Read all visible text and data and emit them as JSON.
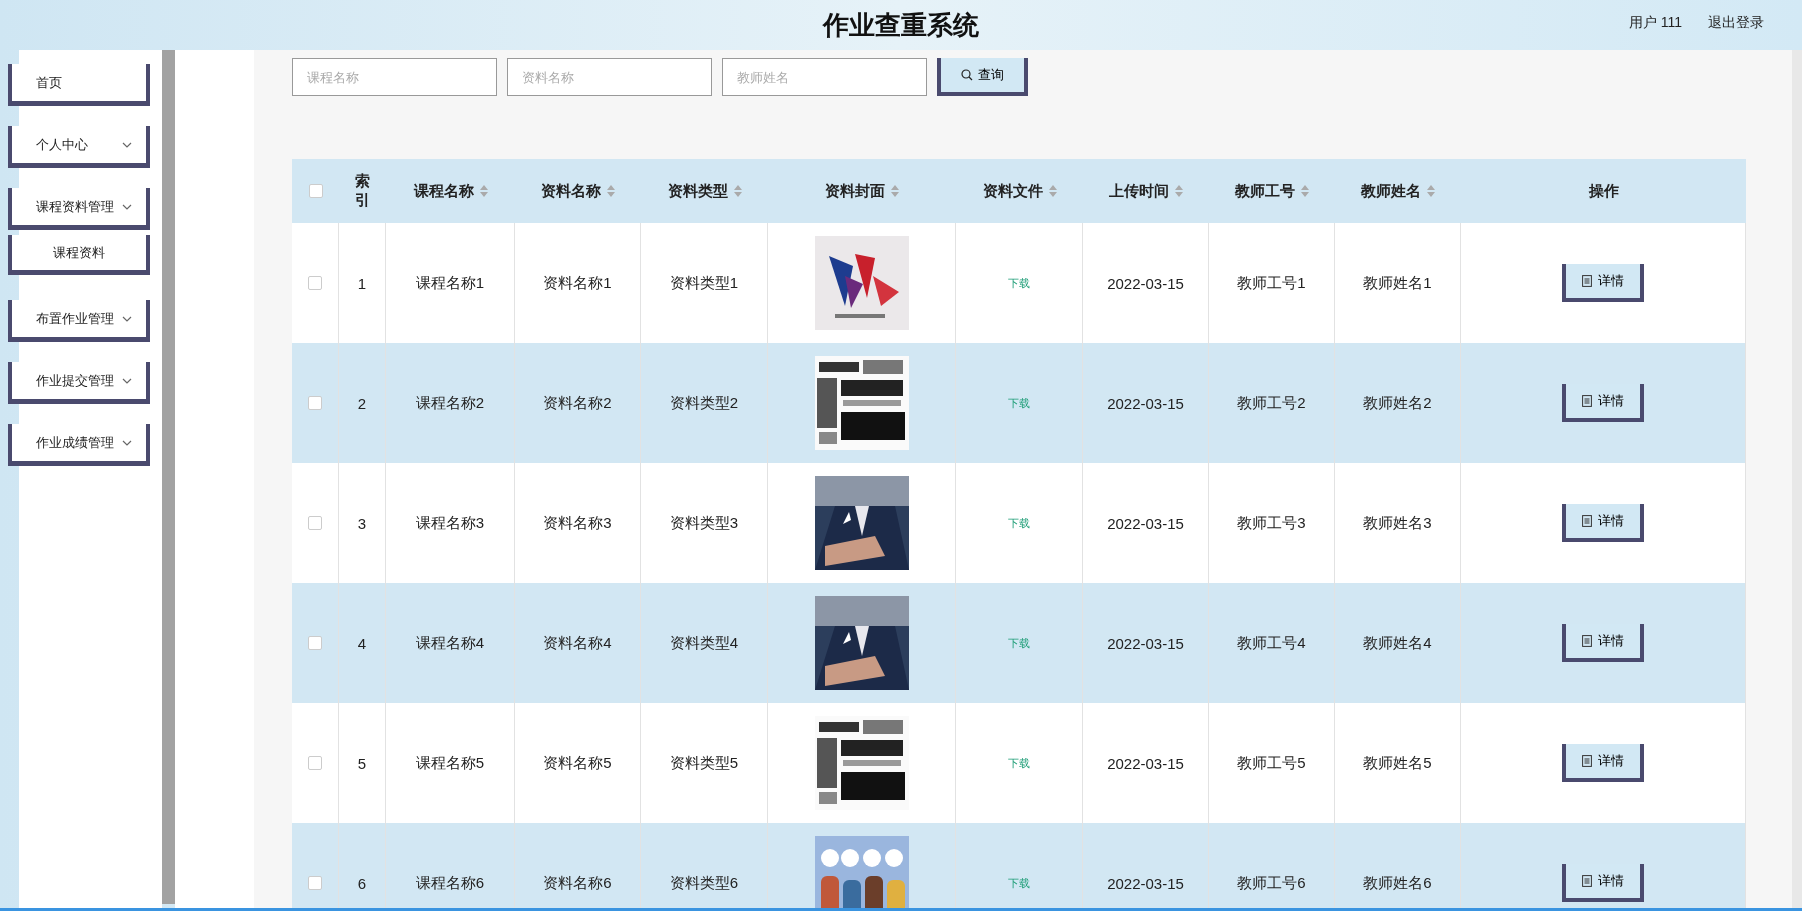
{
  "header": {
    "title": "作业查重系统",
    "user": "用户 111",
    "logout": "退出登录"
  },
  "menu": [
    {
      "kind": "link",
      "label": "首页"
    },
    {
      "kind": "submenu",
      "label": "个人中心"
    },
    {
      "kind": "submenu",
      "label": "课程资料管理",
      "children": [
        {
          "label": "课程资料"
        }
      ]
    },
    {
      "kind": "submenu",
      "label": "布置作业管理"
    },
    {
      "kind": "submenu",
      "label": "作业提交管理"
    },
    {
      "kind": "submenu",
      "label": "作业成绩管理"
    }
  ],
  "search": {
    "fields": [
      {
        "placeholder": "课程名称"
      },
      {
        "placeholder": "资料名称"
      },
      {
        "placeholder": "教师姓名"
      }
    ],
    "button": "查询"
  },
  "table": {
    "select_all": {
      "checked": false
    },
    "columns": [
      {
        "label": "索引",
        "kind": "plain"
      },
      {
        "label": "课程名称",
        "kind": "sortable"
      },
      {
        "label": "资料名称",
        "kind": "sortable"
      },
      {
        "label": "资料类型",
        "kind": "sortable"
      },
      {
        "label": "资料封面",
        "kind": "sortable"
      },
      {
        "label": "资料文件",
        "kind": "sortable"
      },
      {
        "label": "上传时间",
        "kind": "sortable"
      },
      {
        "label": "教师工号",
        "kind": "sortable"
      },
      {
        "label": "教师姓名",
        "kind": "sortable"
      },
      {
        "label": "操作",
        "kind": "plain"
      }
    ],
    "rows": [
      {
        "checked": false,
        "index": "1",
        "course": "课程名称1",
        "name": "资料名称1",
        "type": "资料类型1",
        "file": "下载",
        "time": "2022-03-15",
        "teacher_id": "教师工号1",
        "teacher": "教师姓名1",
        "action": "详情"
      },
      {
        "checked": false,
        "index": "2",
        "course": "课程名称2",
        "name": "资料名称2",
        "type": "资料类型2",
        "file": "下载",
        "time": "2022-03-15",
        "teacher_id": "教师工号2",
        "teacher": "教师姓名2",
        "action": "详情"
      },
      {
        "checked": false,
        "index": "3",
        "course": "课程名称3",
        "name": "资料名称3",
        "type": "资料类型3",
        "file": "下载",
        "time": "2022-03-15",
        "teacher_id": "教师工号3",
        "teacher": "教师姓名3",
        "action": "详情"
      },
      {
        "checked": false,
        "index": "4",
        "course": "课程名称4",
        "name": "资料名称4",
        "type": "资料类型4",
        "file": "下载",
        "time": "2022-03-15",
        "teacher_id": "教师工号4",
        "teacher": "教师姓名4",
        "action": "详情"
      },
      {
        "checked": false,
        "index": "5",
        "course": "课程名称5",
        "name": "资料名称5",
        "type": "资料类型5",
        "file": "下载",
        "time": "2022-03-15",
        "teacher_id": "教师工号5",
        "teacher": "教师姓名5",
        "action": "详情"
      },
      {
        "checked": false,
        "index": "6",
        "course": "课程名称6",
        "name": "资料名称6",
        "type": "资料类型6",
        "file": "下载",
        "time": "2022-03-15",
        "teacher_id": "教师工号6",
        "teacher": "教师姓名6",
        "action": "详情"
      }
    ]
  }
}
